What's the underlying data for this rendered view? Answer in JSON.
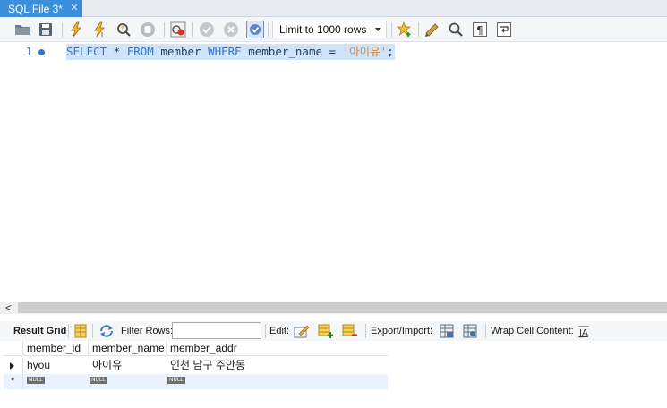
{
  "tab": {
    "title": "SQL File 3*",
    "close_glyph": "✕"
  },
  "toolbar": {
    "limit_select_value": "Limit to 1000 rows",
    "icons": [
      "open-folder-icon",
      "save-icon",
      "execute-icon",
      "execute-current-icon",
      "explain-icon",
      "stop-icon",
      "toggle-error-icon",
      "commit-icon",
      "rollback-icon",
      "autocommit-icon",
      "add-snippet-icon",
      "beautify-icon",
      "find-icon",
      "invisible-chars-icon",
      "word-wrap-icon"
    ]
  },
  "editor": {
    "line_number": "1",
    "sql": {
      "kw_select": "SELECT",
      "star": " * ",
      "kw_from": "FROM",
      "table": " member ",
      "kw_where": "WHERE",
      "rest": " member_name = ",
      "string": "'아이유'",
      "end": ";"
    }
  },
  "scrollbar": {
    "left_glyph": "<"
  },
  "results_toolbar": {
    "result_grid_label": "Result Grid",
    "filter_rows_label": "Filter Rows:",
    "filter_value": "",
    "edit_label": "Edit:",
    "export_import_label": "Export/Import:",
    "wrap_cell_label": "Wrap Cell Content:"
  },
  "grid": {
    "columns": [
      "member_id",
      "member_name",
      "member_addr"
    ],
    "rows": [
      [
        "hyou",
        "아이유",
        "인천 남구 주안동"
      ]
    ],
    "null_label": "NULL",
    "new_row_marker": "*"
  }
}
